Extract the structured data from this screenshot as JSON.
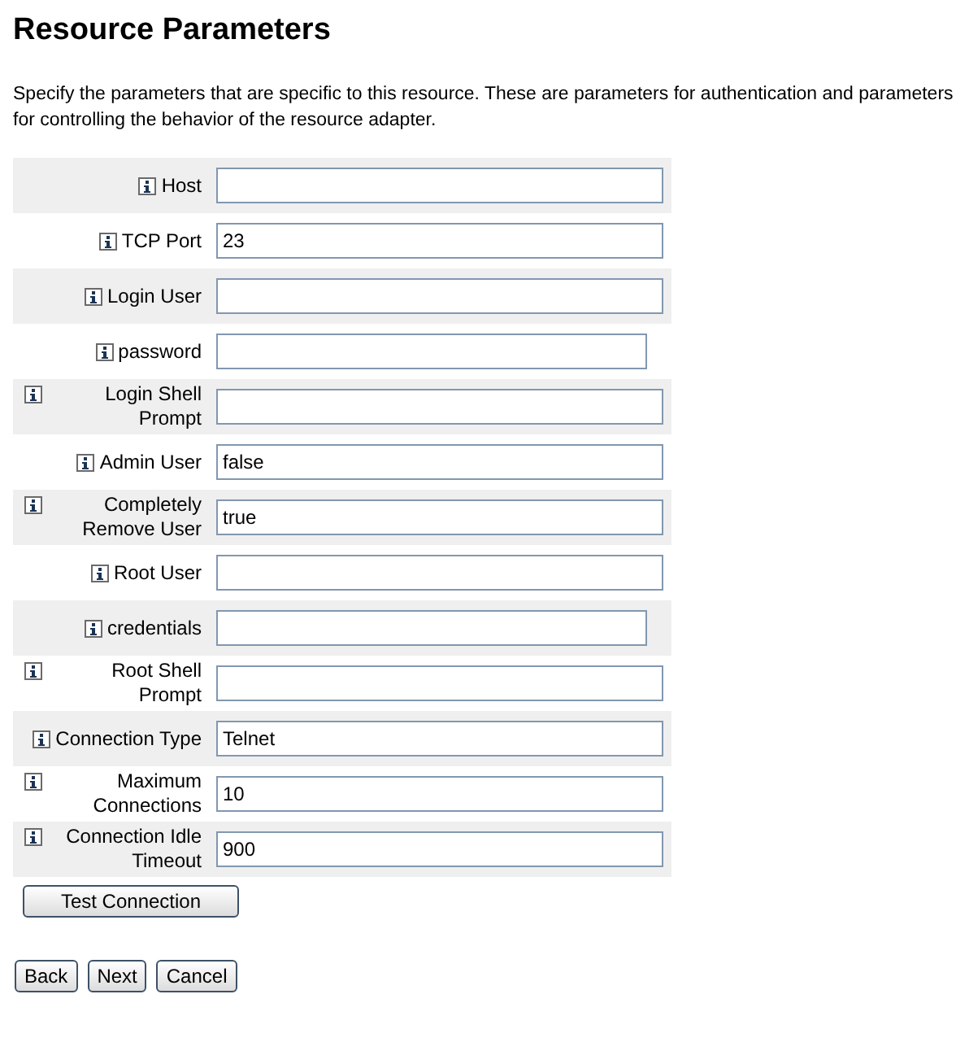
{
  "title": "Resource Parameters",
  "description": "Specify the parameters that are specific to this resource. These are parameters for authentication and parameters for controlling the behavior of the resource adapter.",
  "fields": [
    {
      "label": "Host",
      "kind": "text"
    },
    {
      "label": "TCP Port",
      "kind": "text",
      "value": "23"
    },
    {
      "label": "Login User",
      "kind": "text"
    },
    {
      "label": "password",
      "kind": "password"
    },
    {
      "label": "Login Shell Prompt",
      "kind": "text"
    },
    {
      "label": "Admin User",
      "kind": "text",
      "value": "false"
    },
    {
      "label": "Completely Remove User",
      "kind": "text",
      "value": "true"
    },
    {
      "label": "Root User",
      "kind": "text"
    },
    {
      "label": "credentials",
      "kind": "password"
    },
    {
      "label": "Root Shell Prompt",
      "kind": "text"
    },
    {
      "label": "Connection Type",
      "kind": "text",
      "value": "Telnet"
    },
    {
      "label": "Maximum Connections",
      "kind": "text",
      "value": "10"
    },
    {
      "label": "Connection Idle Timeout",
      "kind": "text",
      "value": "900"
    }
  ],
  "test_button": "Test Connection",
  "buttons": [
    "Back",
    "Next",
    "Cancel"
  ]
}
